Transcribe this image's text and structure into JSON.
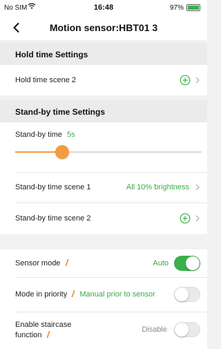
{
  "status_bar": {
    "carrier": "No SIM",
    "time": "16:48",
    "battery": "97%"
  },
  "nav": {
    "title": "Motion sensor:HBT01 3",
    "back_icon": "chevron-left-icon"
  },
  "hold_time": {
    "header": "Hold time Settings",
    "scene_label": "Hold time scene 2"
  },
  "standby": {
    "header": "Stand-by time Settings",
    "time_label": "Stand-by time",
    "time_value": "5s",
    "slider_fraction": 0.25,
    "scene1_label": "Stand-by time scene 1",
    "scene1_value": "All 10% brightness",
    "scene2_label": "Stand-by time scene 2"
  },
  "sensor": {
    "mode_label": "Sensor mode",
    "mode_value": "Auto",
    "mode_on": true,
    "priority_label": "Mode in priority",
    "priority_value": "Manual prior to sensor",
    "priority_on": false,
    "staircase_label_line1": "Enable staircase",
    "staircase_label_line2": "function",
    "staircase_value": "Disable",
    "staircase_on": false
  },
  "colors": {
    "accent_green": "#39b04a",
    "slider_orange": "#f29b3f",
    "info_orange": "#f08a2c"
  }
}
